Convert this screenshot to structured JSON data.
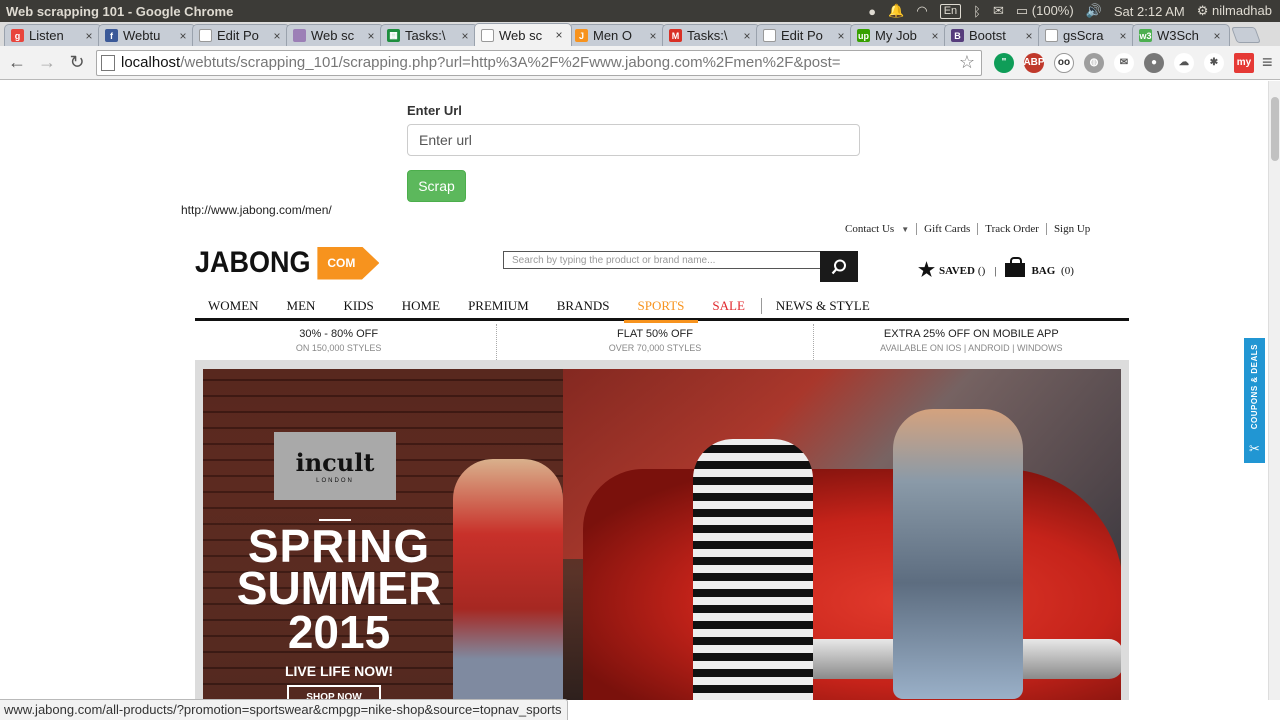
{
  "window_title": "Web scrapping 101 - Google Chrome",
  "system": {
    "keyboard": "En",
    "battery": "(100%)",
    "clock": "Sat  2:12 AM",
    "user": "nilmadhab"
  },
  "tabs": [
    {
      "label": "Listen",
      "favicon_color": "#e8453c",
      "favicon_text": "g",
      "active": false
    },
    {
      "label": "Webtu",
      "favicon_color": "#3b5998",
      "favicon_text": "f",
      "active": false
    },
    {
      "label": "Edit Po",
      "favicon_color": "#ffffff",
      "favicon_text": "",
      "active": false
    },
    {
      "label": "Web sc",
      "favicon_color": "#9c7fb6",
      "favicon_text": "",
      "active": false
    },
    {
      "label": "Tasks:\\",
      "favicon_color": "#1e8e3e",
      "favicon_text": "▦",
      "active": false
    },
    {
      "label": "Web sc",
      "favicon_color": "#ffffff",
      "favicon_text": "",
      "active": true
    },
    {
      "label": "Men O",
      "favicon_color": "#f7931e",
      "favicon_text": "J",
      "active": false
    },
    {
      "label": "Tasks:\\",
      "favicon_color": "#d93025",
      "favicon_text": "M",
      "active": false
    },
    {
      "label": "Edit Po",
      "favicon_color": "#ffffff",
      "favicon_text": "",
      "active": false
    },
    {
      "label": "My Job",
      "favicon_color": "#37a000",
      "favicon_text": "up",
      "active": false
    },
    {
      "label": "Bootst",
      "favicon_color": "#563d7c",
      "favicon_text": "B",
      "active": false
    },
    {
      "label": "gsScra",
      "favicon_color": "#ffffff",
      "favicon_text": "",
      "active": false
    },
    {
      "label": "W3Sch",
      "favicon_color": "#4caf50",
      "favicon_text": "w3",
      "active": false
    }
  ],
  "address_bar": {
    "host": "localhost",
    "path": "/webtuts/scrapping_101/scrapping.php?url=http%3A%2F%2Fwww.jabong.com%2Fmen%2F&post="
  },
  "form": {
    "label": "Enter Url",
    "input_placeholder": "Enter url",
    "button_label": "Scrap"
  },
  "scraped_url": "http://www.jabong.com/men/",
  "jabong": {
    "util_links": [
      "Contact Us",
      "Gift Cards",
      "Track Order",
      "Sign Up"
    ],
    "logo_word": "JABONG",
    "logo_tag": "COM",
    "search_placeholder": "Search by typing the product or brand name...",
    "saved_label": "SAVED",
    "saved_count": "()",
    "bag_label": "BAG",
    "bag_count": "(0)",
    "nav": [
      "WOMEN",
      "MEN",
      "KIDS",
      "HOME",
      "PREMIUM",
      "BRANDS",
      "SPORTS",
      "SALE",
      "NEWS & STYLE"
    ],
    "promos": [
      {
        "title": "30% - 80% OFF",
        "sub": "ON 150,000 STYLES"
      },
      {
        "title": "FLAT 50% OFF",
        "sub": "OVER 70,000 STYLES"
      },
      {
        "title": "EXTRA 25% OFF ON MOBILE APP",
        "sub": "AVAILABLE ON IOS | ANDROID | WINDOWS"
      }
    ],
    "banner": {
      "brand": "incult",
      "brand_sub": "LONDON",
      "line1": "SPRING",
      "line2": "SUMMER",
      "line3": "2015",
      "tagline": "LIVE LIFE NOW!",
      "cta": "SHOP NOW"
    },
    "coupons_tab": "COUPONS & DEALS"
  },
  "status_url": "www.jabong.com/all-products/?promotion=sportswear&cmpgp=nike-shop&source=topnav_sports"
}
